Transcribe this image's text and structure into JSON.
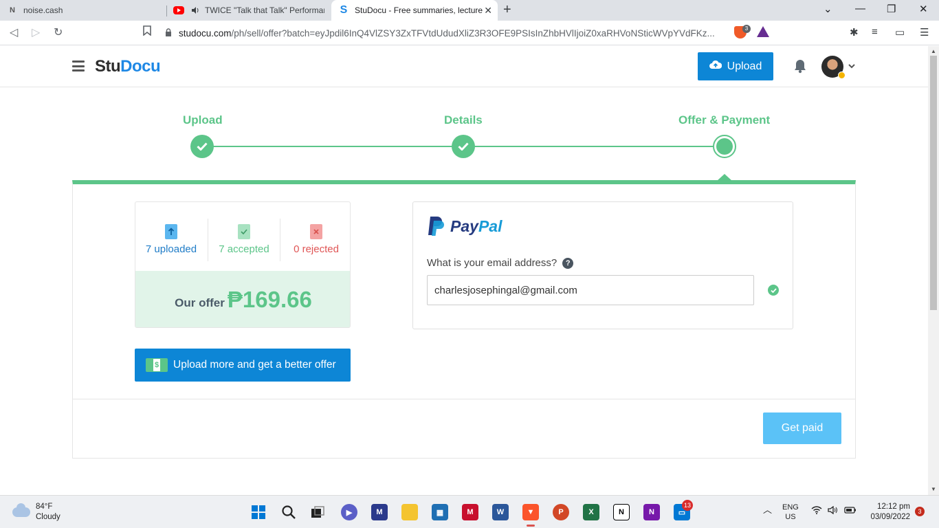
{
  "browser": {
    "tabs": [
      {
        "title": "noise.cash",
        "favicon": "N"
      },
      {
        "title": "TWICE \"Talk that Talk\" Performance",
        "favicon": "youtube-icon"
      },
      {
        "title": "StuDocu - Free summaries, lecture",
        "favicon": "S"
      }
    ],
    "url_host": "studocu.com",
    "url_path": "/ph/sell/offer?batch=eyJpdil6InQ4VlZSY3ZxTFVtdUdudXliZ3R3OFE9PSIsInZhbHVlIjoiZ0xaRHVoNSticWVpYVdFKz...",
    "shield_count": "3"
  },
  "header": {
    "logo_stu": "Stu",
    "logo_docu": "Docu",
    "upload_label": "Upload"
  },
  "stepper": {
    "steps": [
      {
        "label": "Upload",
        "state": "done"
      },
      {
        "label": "Details",
        "state": "done"
      },
      {
        "label": "Offer & Payment",
        "state": "current"
      }
    ]
  },
  "stats": {
    "uploaded": "7 uploaded",
    "accepted": "7 accepted",
    "rejected": "0 rejected",
    "offer_label": "Our offer",
    "offer_amount": "₱169.66"
  },
  "actions": {
    "upload_more": "Upload more and get a better offer",
    "get_paid": "Get paid"
  },
  "paypal": {
    "brand_pay": "Pay",
    "brand_pal": "Pal",
    "email_label": "What is your email address?",
    "email_value": "charlesjosephingal@gmail.com"
  },
  "taskbar": {
    "temperature": "84°F",
    "condition": "Cloudy",
    "lang_top": "ENG",
    "lang_bottom": "US",
    "time": "12:12 pm",
    "date": "03/09/2022",
    "onedrive_badge": "13",
    "notification_count": "3"
  },
  "colors": {
    "brand_blue": "#0d86d6",
    "success_green": "#5cc589",
    "offer_bg": "#e1f4e9",
    "get_paid_disabled": "#5bc2f7"
  }
}
